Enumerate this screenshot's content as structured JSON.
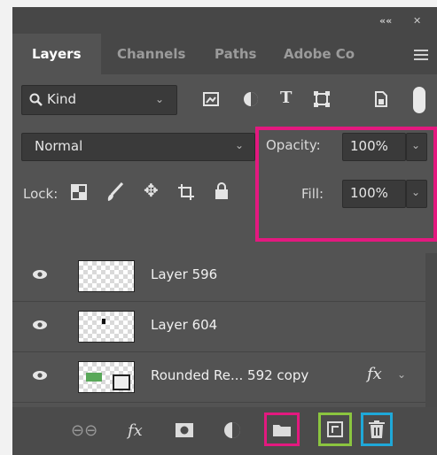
{
  "topstrip": {
    "collapse": "««",
    "close": "✕"
  },
  "tabs": [
    "Layers",
    "Channels",
    "Paths",
    "Adobe Co"
  ],
  "filter": {
    "icon": "search-icon",
    "label": "Kind"
  },
  "blend": {
    "mode": "Normal",
    "opacity_label": "Opacity:",
    "opacity_value": "100%"
  },
  "lock": {
    "label": "Lock:",
    "fill_label": "Fill:",
    "fill_value": "100%"
  },
  "layers": [
    {
      "name": "Layer 596"
    },
    {
      "name": "Layer 604"
    },
    {
      "name": "Rounded Re... 592 copy",
      "fx": "fx"
    }
  ],
  "bottom": {
    "fx": "fx"
  },
  "colors": {
    "highlight_pink": "#e3197f",
    "highlight_green": "#8bc53f",
    "highlight_cyan": "#1fa8d8",
    "panel": "#535353"
  }
}
